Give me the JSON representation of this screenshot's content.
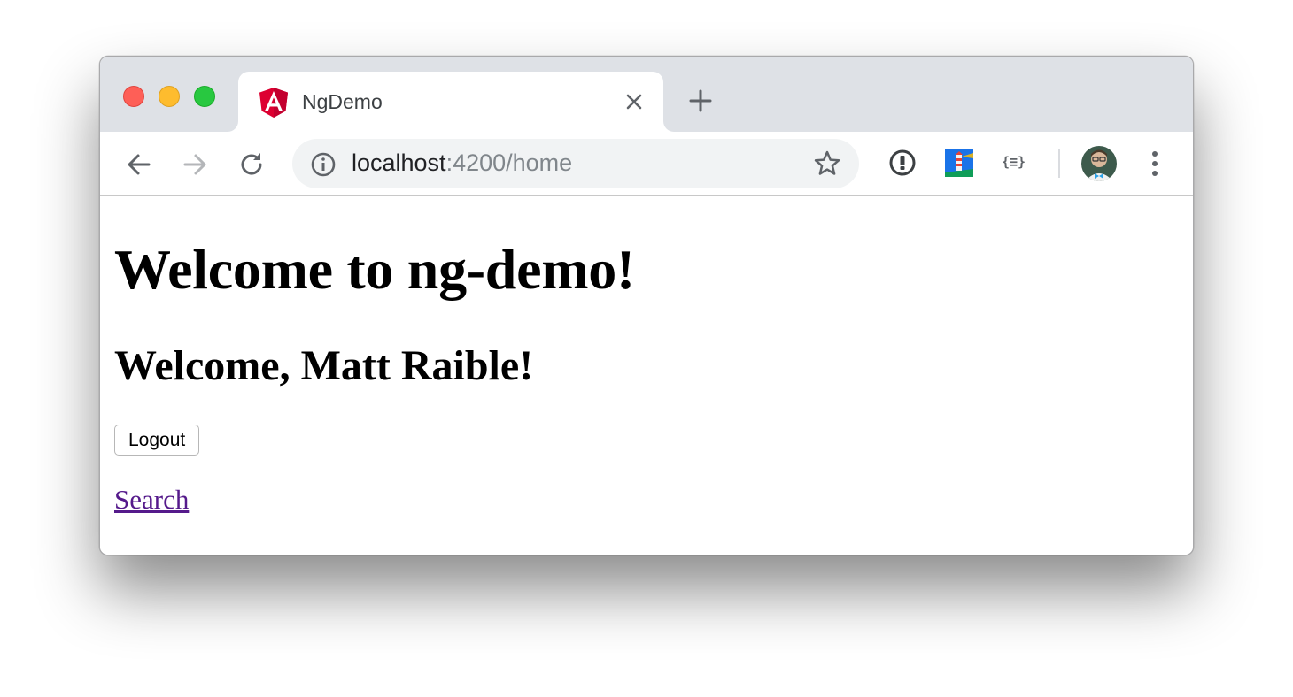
{
  "browser": {
    "tab": {
      "title": "NgDemo",
      "favicon": "angular-icon"
    },
    "address_bar": {
      "host": "localhost",
      "rest": ":4200/home"
    },
    "toolbar_icons": [
      "back-arrow-icon",
      "forward-arrow-icon",
      "reload-icon",
      "info-icon",
      "star-icon",
      "password-manager-icon",
      "lighthouse-icon",
      "json-formatter-icon",
      "profile-avatar",
      "menu-dots-icon"
    ],
    "extension_json_label": "{≡}"
  },
  "page": {
    "heading": "Welcome to ng-demo!",
    "greeting": "Welcome, Matt Raible!",
    "logout_label": "Logout",
    "search_link": "Search"
  },
  "colors": {
    "angular_red": "#dd0031",
    "visited_link": "#551a8b",
    "url_grey": "#80868b"
  }
}
